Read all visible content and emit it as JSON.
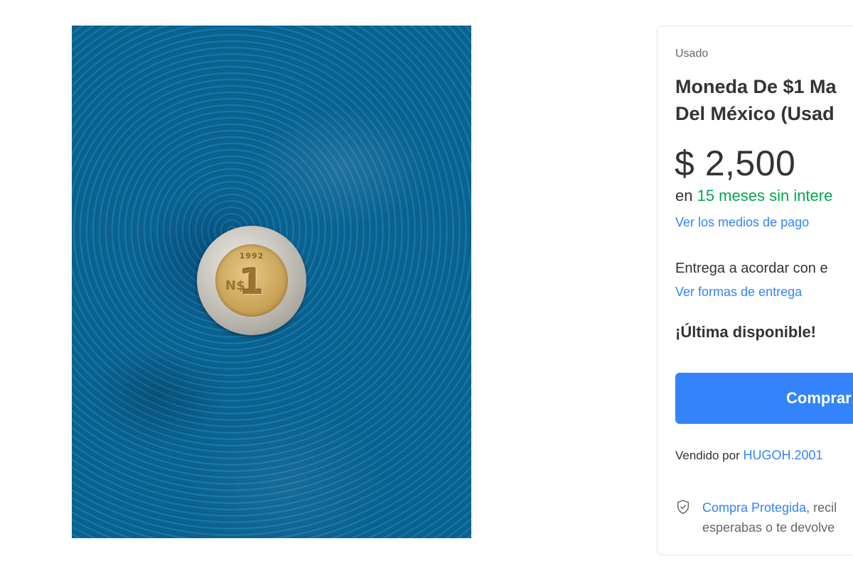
{
  "product": {
    "image_alt": "1992 N$1 coin on blue fabric",
    "coin": {
      "year": "1992",
      "denomination": "1",
      "currency_mark": "N$"
    }
  },
  "purchase": {
    "condition": "Usado",
    "title_line1": "Moneda De $1 Ma",
    "title_line2": "Del México (Usad",
    "price": "$ 2,500",
    "installments_prefix": "en ",
    "installments_highlight": "15 meses sin intere",
    "payment_methods_link": "Ver los medios de pago",
    "delivery_text": "Entrega a acordar con e",
    "delivery_link": "Ver formas de entrega",
    "stock_text": "¡Última disponible!",
    "buy_button_label": "Comprar",
    "seller_prefix": "Vendido por",
    "seller_name": "HUGOH.2001",
    "protection_link": "Compra Protegida",
    "protection_text_line1_rest": ", recil",
    "protection_text_line2": "esperabas o te devolve"
  },
  "colors": {
    "accent_blue": "#3483fa",
    "installments_green": "#00a650"
  }
}
